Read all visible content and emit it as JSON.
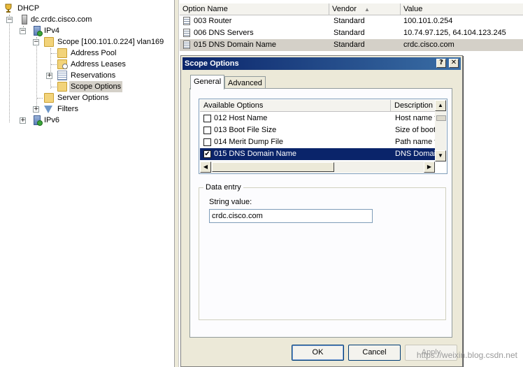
{
  "tree": {
    "root": "DHCP",
    "server": "dc.crdc.cisco.com",
    "ipv4": "IPv4",
    "scope": "Scope [100.101.0.224] vlan169",
    "address_pool": "Address Pool",
    "address_leases": "Address Leases",
    "reservations": "Reservations",
    "scope_options": "Scope Options",
    "server_options": "Server Options",
    "filters": "Filters",
    "ipv6": "IPv6",
    "expand_symbol": "+",
    "collapse_symbol": "−"
  },
  "list": {
    "columns": {
      "option_name": "Option Name",
      "vendor": "Vendor",
      "value": "Value"
    },
    "rows": [
      {
        "name": "003 Router",
        "vendor": "Standard",
        "value": "100.101.0.254"
      },
      {
        "name": "006 DNS Servers",
        "vendor": "Standard",
        "value": "10.74.97.125, 64.104.123.245"
      },
      {
        "name": "015 DNS Domain Name",
        "vendor": "Standard",
        "value": "crdc.cisco.com"
      }
    ],
    "sort_indicator": "▲"
  },
  "dialog": {
    "title": "Scope Options",
    "help_glyph": "?",
    "close_glyph": "✕",
    "tabs": {
      "general": "General",
      "advanced": "Advanced"
    },
    "options_table": {
      "col_available": "Available Options",
      "col_description": "Description",
      "rows": [
        {
          "option": "012 Host Name",
          "description": "Host name f",
          "checked": false
        },
        {
          "option": "013 Boot File Size",
          "description": "Size of boot",
          "checked": false
        },
        {
          "option": "014 Merit Dump File",
          "description": "Path name f",
          "checked": false
        },
        {
          "option": "015 DNS Domain Name",
          "description": "DNS Domai",
          "checked": true
        }
      ],
      "check_glyph": "✔"
    },
    "data_entry": {
      "legend": "Data entry",
      "string_label": "String value:",
      "string_value": "crdc.cisco.com"
    },
    "buttons": {
      "ok": "OK",
      "cancel": "Cancel",
      "apply": "Apply"
    }
  },
  "watermark": "https://weixin.blog.csdn.net",
  "colors": {
    "titlebar": "#0a246a",
    "selection": "#0a246a",
    "dialog_bg": "#ece9d8"
  }
}
